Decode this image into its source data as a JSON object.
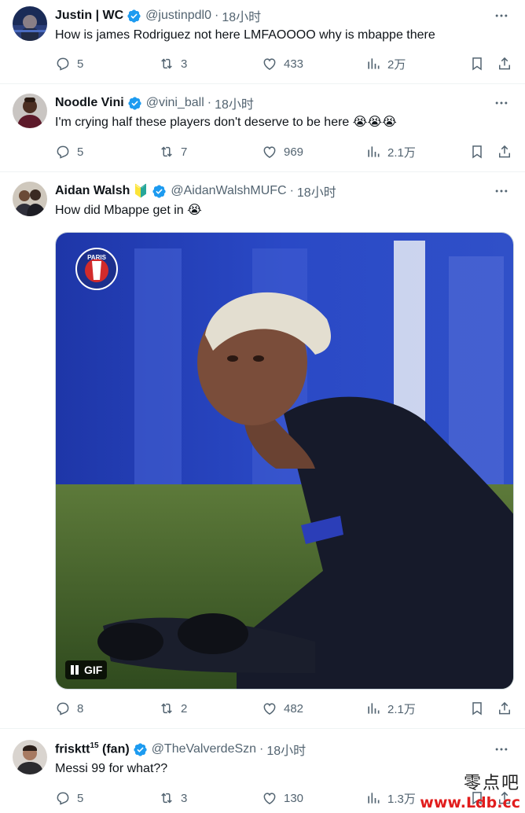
{
  "tweets": [
    {
      "name": "Justin | WC",
      "badge": "",
      "handle": "@justinpdl0",
      "time": "18小时",
      "text": "How is james Rodriguez not here LMFAOOOO why is mbappe there",
      "emojis": "",
      "replies": "5",
      "reposts": "3",
      "likes": "433",
      "views": "2万"
    },
    {
      "name": "Noodle Vini",
      "badge": "",
      "handle": "@vini_ball",
      "time": "18小时",
      "text": "I'm crying half these players don't deserve to be here",
      "emojis": "😭😭😭",
      "replies": "5",
      "reposts": "7",
      "likes": "969",
      "views": "2.1万"
    },
    {
      "name": "Aidan Walsh",
      "badge": "🔰",
      "handle": "@AidanWalshMUFC",
      "time": "18小时",
      "text": "How did Mbappe get in",
      "emojis": "😭",
      "media_label": "GIF",
      "media_logo": "PARIS",
      "replies": "8",
      "reposts": "2",
      "likes": "482",
      "views": "2.1万"
    },
    {
      "name": "frisktt",
      "name_sup": "15",
      "name_suffix": " (fan)",
      "badge": "",
      "handle": "@TheValverdeSzn",
      "time": "18小时",
      "text": "Messi 99 for what??",
      "emojis": "",
      "replies": "5",
      "reposts": "3",
      "likes": "130",
      "views": "1.3万"
    }
  ],
  "watermark": {
    "top": "零点吧",
    "bottom": "www.Ldb.cc"
  },
  "colors": {
    "verified": "#1d9bf0",
    "secondary": "#536471",
    "text": "#0f1419"
  }
}
